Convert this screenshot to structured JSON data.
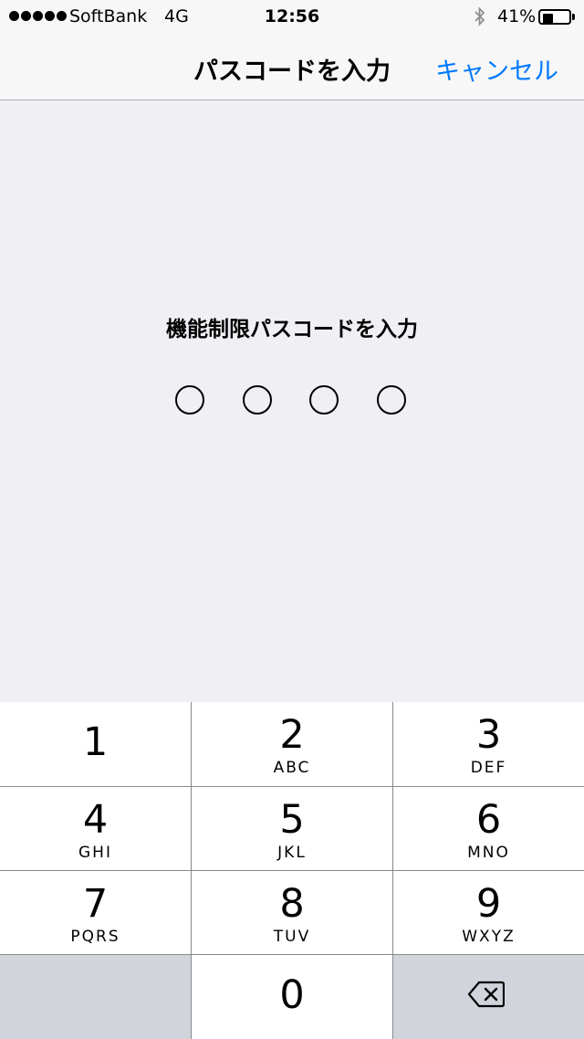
{
  "status_bar": {
    "carrier": "SoftBank",
    "network": "4G",
    "time": "12:56",
    "battery_percent": "41%",
    "battery_level": 0.41,
    "signal_bars": 5
  },
  "nav": {
    "title": "パスコードを入力",
    "cancel_label": "キャンセル"
  },
  "content": {
    "prompt": "機能制限パスコードを入力",
    "passcode_length": 4,
    "entered_digits": 0
  },
  "keypad": {
    "keys": [
      {
        "digit": "1",
        "letters": ""
      },
      {
        "digit": "2",
        "letters": "ABC"
      },
      {
        "digit": "3",
        "letters": "DEF"
      },
      {
        "digit": "4",
        "letters": "GHI"
      },
      {
        "digit": "5",
        "letters": "JKL"
      },
      {
        "digit": "6",
        "letters": "MNO"
      },
      {
        "digit": "7",
        "letters": "PQRS"
      },
      {
        "digit": "8",
        "letters": "TUV"
      },
      {
        "digit": "9",
        "letters": "WXYZ"
      },
      {
        "digit": "0",
        "letters": ""
      }
    ]
  },
  "colors": {
    "accent": "#007aff",
    "background": "#efeff4",
    "key_background": "#ffffff",
    "dark_key_background": "#d1d5db"
  }
}
